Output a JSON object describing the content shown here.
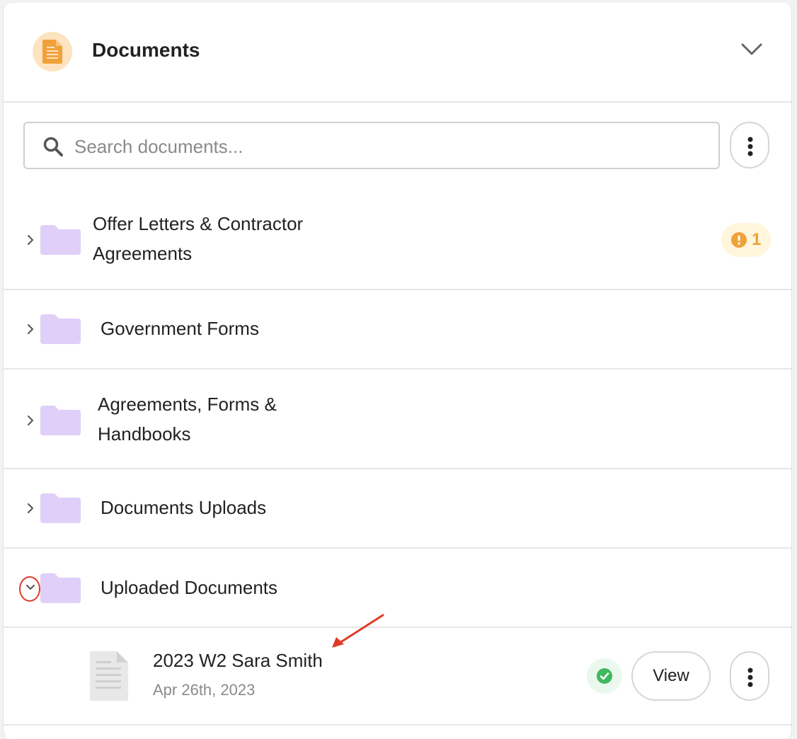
{
  "header": {
    "title": "Documents",
    "icon": "document-icon",
    "icon_color": "#f0a13a",
    "toggle_icon": "chevron-down-icon"
  },
  "search": {
    "placeholder": "Search documents...",
    "value": "",
    "icon": "search-icon"
  },
  "folders": [
    {
      "label_line1": "Offer Letters & Contractor",
      "label_line2": "Agreements",
      "badge_count": "1",
      "badge_icon": "warning-icon",
      "expanded": false
    },
    {
      "label_line1": "Government Forms",
      "expanded": false
    },
    {
      "label_line1": "Agreements, Forms &",
      "label_line2": "Handbooks",
      "expanded": false
    },
    {
      "label_line1": "Documents Uploads",
      "expanded": false
    },
    {
      "label_line1": "Uploaded Documents",
      "expanded": true
    }
  ],
  "documents": [
    {
      "title": "2023 W2 Sara Smith",
      "date": "Apr 26th, 2023",
      "status_icon": "check-circle-icon",
      "action_label": "View"
    }
  ],
  "colors": {
    "folder": "#e0cff8",
    "badge_bg": "#fff6dc",
    "badge_text": "#f0a13a",
    "success": "#3fb85f",
    "annotation": "#e03b2a"
  }
}
